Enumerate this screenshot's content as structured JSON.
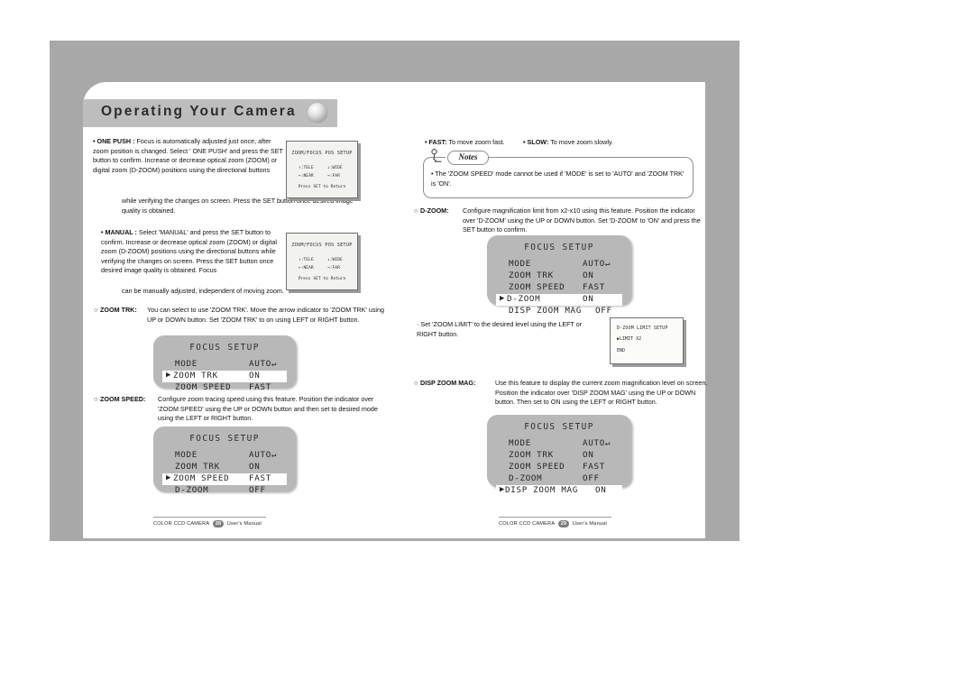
{
  "header": {
    "title": "Operating Your Camera",
    "ball_icon": "sphere-bullet-icon"
  },
  "left_column": {
    "one_push": {
      "lead": "• ONE PUSH :",
      "body": "Focus is automatically adjusted just once, after zoom position is changed. Select ' ONE PUSH' and press the SET button to confirm. Increase or decrease optical zoom (ZOOM) or digital zoom (D-ZOOM) positions using the directional buttons",
      "body_tail": "while verifying the changes on screen. Press the SET button once desired image quality is obtained."
    },
    "manual": {
      "lead": "• MANUAL :",
      "body": "Select 'MANUAL' and press the SET button to confirm. Increase or decrease optical zoom (ZOOM) or digital zoom (D-ZOOM) positions using the directional buttons while verifying the changes on screen. Press the SET button once desired image quality is obtained. Focus",
      "body_tail": "can be manually adjusted, independent of moving zoom."
    },
    "zoom_trk": {
      "lead": "ZOOM TRK:",
      "bullet": "○",
      "body": "You can select to use 'ZOOM TRK'. Move the arrow indicator to 'ZOOM TRK' using UP or DOWN button. Set 'ZOOM TRK' to on using LEFT or RIGHT button."
    },
    "zoom_speed": {
      "lead": "ZOOM SPEED:",
      "bullet": "○",
      "body": "Configure zoom tracing speed using this feature. Position the indicator over 'ZOOM SPEED' using the UP or DOWN button and then set to desired mode using the LEFT or RIGHT button."
    }
  },
  "right_column": {
    "fast": {
      "lead": "• FAST:",
      "body": "To move zoom fast."
    },
    "slow": {
      "lead": "• SLOW:",
      "body": "To move zoom slowly."
    },
    "notes": {
      "caption": "Notes",
      "text": "• The 'ZOOM SPEED' mode cannot be used if 'MODE' is set to 'AUTO' and 'ZOOM TRK' is 'ON'.",
      "pin_icon": "push-pin-icon"
    },
    "d_zoom": {
      "lead": "D-ZOOM:",
      "bullet": "○",
      "body": "Configure magnification limit from x2-x10 using this feature. Position the indicator over 'D-ZOOM' using the UP or DOWN button. Set 'D-ZOOM' to 'ON' and press the SET button to confirm."
    },
    "zoom_limit_note": {
      "body": "· Set 'ZOOM LIMIT' to the desired level using the LEFT or RIGHT button."
    },
    "disp_zoom_mag": {
      "lead": "DISP ZOOM MAG:",
      "bullet": "○",
      "body": "Use this feature to display the current zoom magnification level on screen. Position the indicator over 'DISP ZOOM MAG' using the UP or DOWN button. Then set to ON using the LEFT or RIGHT button."
    }
  },
  "osd_pos_setup": {
    "title": "ZOOM/FOCUS POS SETUP",
    "row1_left": "↑:TELE",
    "row1_right": "↓:WIDE",
    "row2_left": "←:NEAR",
    "row2_right": "→:FAR",
    "footer": "Press SET to Return"
  },
  "menus": [
    {
      "id": "focus-setup-zoom-trk",
      "title": "FOCUS SETUP",
      "rows": [
        {
          "label": "MODE",
          "value": "AUTO↵",
          "selected": false
        },
        {
          "label": "ZOOM TRK",
          "value": "ON",
          "selected": true
        },
        {
          "label": "ZOOM SPEED",
          "value": "FAST",
          "selected": false
        }
      ]
    },
    {
      "id": "focus-setup-zoom-speed",
      "title": "FOCUS SETUP",
      "rows": [
        {
          "label": "MODE",
          "value": "AUTO↵",
          "selected": false
        },
        {
          "label": "ZOOM TRK",
          "value": "ON",
          "selected": false
        },
        {
          "label": "ZOOM SPEED",
          "value": "FAST",
          "selected": true
        },
        {
          "label": "D-ZOOM",
          "value": "OFF",
          "selected": false
        }
      ]
    },
    {
      "id": "focus-setup-d-zoom",
      "title": "FOCUS SETUP",
      "rows": [
        {
          "label": "MODE",
          "value": "AUTO↵",
          "selected": false
        },
        {
          "label": "ZOOM TRK",
          "value": "ON",
          "selected": false
        },
        {
          "label": "ZOOM SPEED",
          "value": "FAST",
          "selected": false
        },
        {
          "label": "D-ZOOM",
          "value": "ON",
          "selected": true
        },
        {
          "label": "DISP ZOOM MAG",
          "value": "OFF",
          "selected": false
        }
      ]
    },
    {
      "id": "focus-setup-disp-zoom-mag",
      "title": "FOCUS SETUP",
      "rows": [
        {
          "label": "MODE",
          "value": "AUTO↵",
          "selected": false
        },
        {
          "label": "ZOOM TRK",
          "value": "ON",
          "selected": false
        },
        {
          "label": "ZOOM SPEED",
          "value": "FAST",
          "selected": false
        },
        {
          "label": "D-ZOOM",
          "value": "OFF",
          "selected": false
        },
        {
          "label": "DISP ZOOM MAG",
          "value": "ON",
          "selected": true
        }
      ]
    }
  ],
  "limit_setup": {
    "title": "D-ZOOM LIMIT SETUP",
    "row": "▶LIMIT X2",
    "end": "END"
  },
  "footers": {
    "left": {
      "brand": "COLOR CCD CAMERA",
      "page": "28",
      "manual": "User's Manual"
    },
    "right": {
      "brand": "COLOR CCD CAMERA",
      "page": "29",
      "manual": "User's Manual"
    }
  },
  "colors": {
    "panel_grey": "#a8a8a8",
    "header_grey": "#bdbdbd",
    "menu_grey": "#b8b8b8",
    "osd_bg": "#f2f2f0"
  }
}
